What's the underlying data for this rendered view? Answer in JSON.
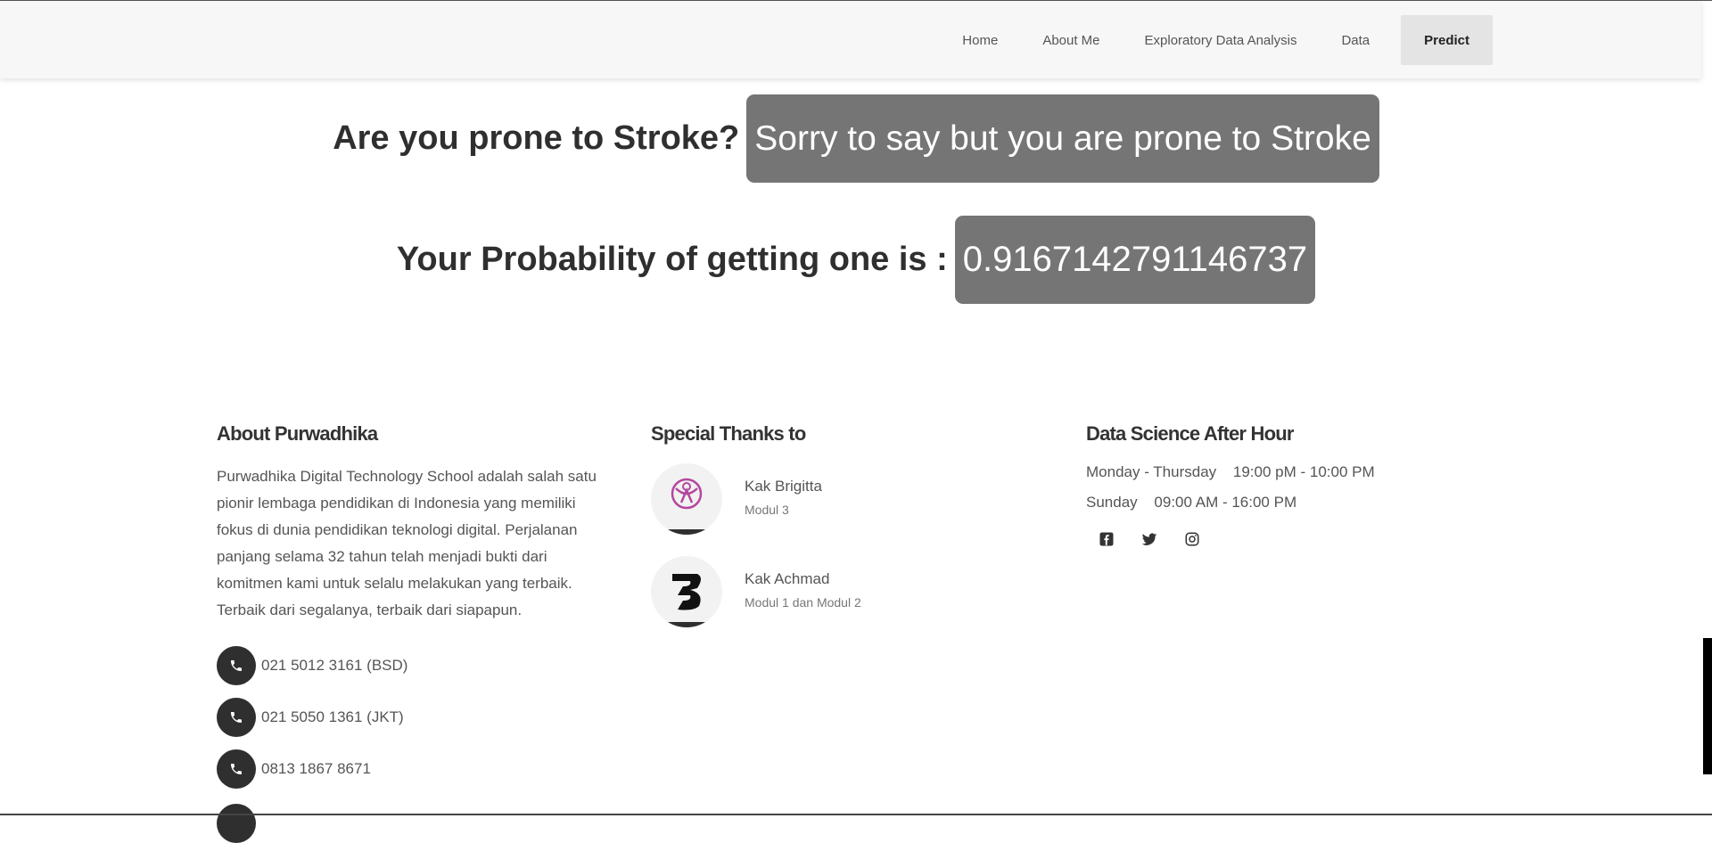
{
  "nav": {
    "items": [
      {
        "label": "Home"
      },
      {
        "label": "About Me"
      },
      {
        "label": "Exploratory Data Analysis"
      },
      {
        "label": "Data"
      }
    ],
    "active_label": "Predict"
  },
  "result": {
    "question": "Are you prone to Stroke?",
    "answer": "Sorry to say but you are prone to Stroke",
    "probability_label": "Your Probability of getting one is :",
    "probability_value": "0.9167142791146737"
  },
  "footer": {
    "about": {
      "heading": "About Purwadhika",
      "text": "Purwadhika Digital Technology School adalah salah satu pionir lembaga pendidikan di Indonesia yang memiliki fokus di dunia pendidikan teknologi digital. Perjalanan panjang selama 32 tahun telah menjadi bukti dari komitmen kami untuk selalu melakukan yang terbaik. Terbaik dari segalanya, terbaik dari siapapun.",
      "contacts": [
        {
          "text": "021 5012 3161 (BSD)"
        },
        {
          "text": "021 5050 1361 (JKT)"
        },
        {
          "text": "0813 1867 8671"
        }
      ]
    },
    "thanks": {
      "heading": "Special Thanks to",
      "people": [
        {
          "name": "Kak Brigitta",
          "module": "Modul 3"
        },
        {
          "name": "Kak Achmad",
          "module": "Modul 1 dan Modul 2"
        }
      ]
    },
    "hours": {
      "heading": "Data Science After Hour",
      "schedule": [
        {
          "day": "Monday - Thursday",
          "time": "19:00 pM - 10:00 PM"
        },
        {
          "day": "Sunday",
          "time": "09:00 AM - 16:00 PM"
        }
      ],
      "socials": [
        "facebook-icon",
        "twitter-icon",
        "instagram-icon"
      ]
    }
  },
  "colors": {
    "navbar_bg": "#f7f7f7",
    "result_box": "#757575",
    "icon_dark": "#2f2f2f"
  }
}
